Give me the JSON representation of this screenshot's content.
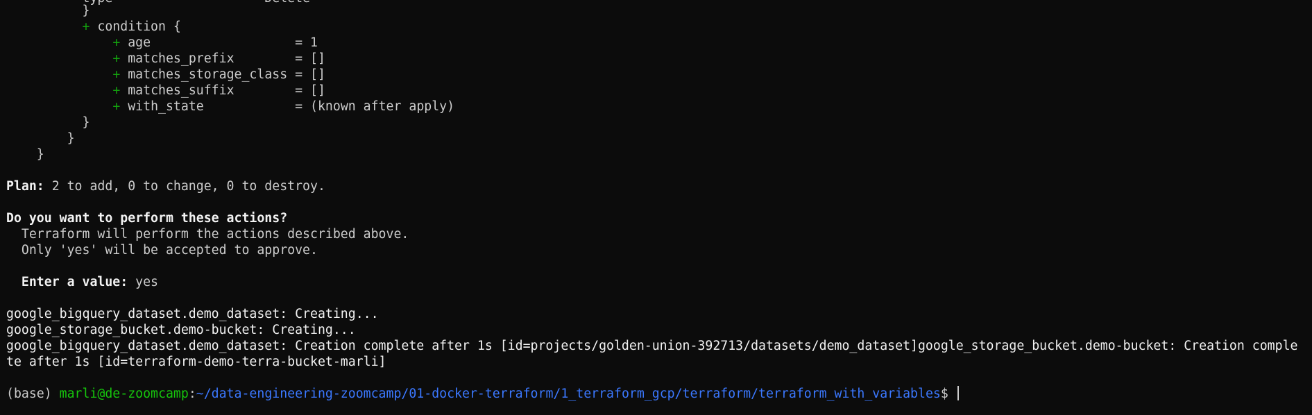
{
  "plan_tail": {
    "line0": "          type                 = \"Delete\"",
    "brace1": "          }",
    "condition_plus": "+",
    "condition_label": "condition {",
    "attrs": [
      {
        "plus": "+",
        "key": "age                  ",
        "value": "= 1"
      },
      {
        "plus": "+",
        "key": "matches_prefix       ",
        "value": "= []"
      },
      {
        "plus": "+",
        "key": "matches_storage_class",
        "value": "= []"
      },
      {
        "plus": "+",
        "key": "matches_suffix       ",
        "value": "= []"
      },
      {
        "plus": "+",
        "key": "with_state           ",
        "value": "= (known after apply)"
      }
    ],
    "brace2": "          }",
    "brace3": "        }",
    "brace4": "    }"
  },
  "plan_summary": {
    "label": "Plan:",
    "text": " 2 to add, 0 to change, 0 to destroy."
  },
  "confirm": {
    "question": "Do you want to perform these actions?",
    "line1": "  Terraform will perform the actions described above.",
    "line2": "  Only 'yes' will be accepted to approve.",
    "prompt_label": "  Enter a value:",
    "prompt_value": " yes"
  },
  "apply_output": [
    "google_bigquery_dataset.demo_dataset: Creating...",
    "google_storage_bucket.demo-bucket: Creating...",
    "google_bigquery_dataset.demo_dataset: Creation complete after 1s [id=projects/golden-union-392713/datasets/demo_dataset]google_storage_bucket.demo-bucket: Creation comple",
    "te after 1s [id=terraform-demo-terra-bucket-marli]"
  ],
  "prompt": {
    "env": "(base) ",
    "user_host": "marli@de-zoomcamp",
    "colon": ":",
    "path": "~/data-engineering-zoomcamp/01-docker-terraform/1_terraform_gcp/terraform/terraform_with_variables",
    "dollar": "$ "
  }
}
